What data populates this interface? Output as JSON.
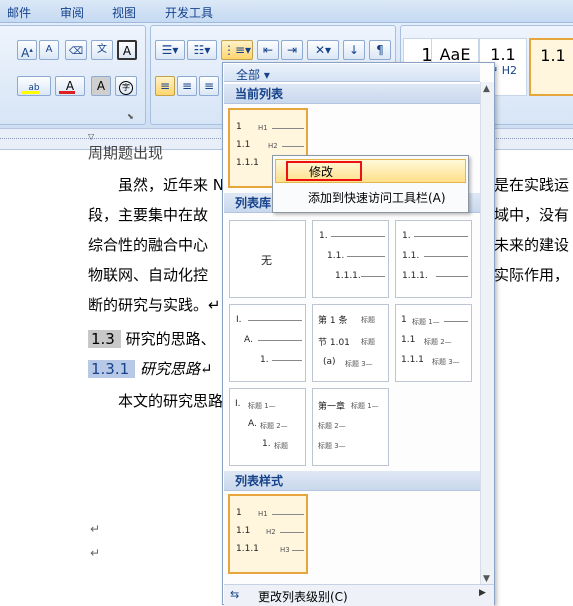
{
  "tabs": [
    "邮件",
    "审阅",
    "视图",
    "开发工具"
  ],
  "ribbon": {
    "font_grow": "A",
    "font_shrink": "A",
    "pinyin": "文",
    "wen_char": "文",
    "border_char": "A",
    "style_samples": [
      {
        "big": "1",
        "small": ""
      },
      {
        "big": "AaE",
        "small": ""
      },
      {
        "big": "1.1",
        "small": "↵ H2"
      },
      {
        "big": "1.1",
        "small": ""
      }
    ],
    "aa_box": "A",
    "circle_char": "字"
  },
  "document": {
    "line_top": "周期题出现",
    "line1_a": "虽然，近年来 N",
    "line1_b": "是在实践运",
    "line2_a": "段，主要集中在故",
    "line2_b": "域中，没有",
    "line3_a": "综合性的融合中心",
    "line3_b": "未来的建设",
    "line4_a": "物联网、自动化控",
    "line4_b": "实际作用，",
    "line5": "断的研究与实践。↵",
    "h13_num": "1.3",
    "h13_text": "研究的思路、",
    "h131_num": "1.3.1",
    "h131_text": "研究思路↵",
    "line6": "本文的研究思路",
    "para_mark1": "↵",
    "para_mark2": "↵"
  },
  "panel": {
    "all_label": "全部 ▾",
    "current_section": "当前列表",
    "library_section": "列表库",
    "styles_section": "列表样式",
    "none_label": "无",
    "footer_label": "更改列表级别(C)",
    "footer_accel": "C"
  },
  "current_tile": {
    "rows": [
      {
        "num": "1",
        "label": "H1"
      },
      {
        "num": "1.1",
        "label": "H2"
      },
      {
        "num": "1.1.1",
        "label": ""
      }
    ]
  },
  "library_tiles": [
    {
      "rows": [
        {
          "num": "1."
        },
        {
          "num": "1.1."
        },
        {
          "num": "1.1.1."
        }
      ]
    },
    {
      "rows": [
        {
          "num": "1."
        },
        {
          "num": "1.1."
        },
        {
          "num": "1.1.1."
        }
      ]
    },
    {
      "rows": [
        {
          "num": "I."
        },
        {
          "num": "A."
        },
        {
          "num": "1."
        }
      ]
    },
    {
      "rows": [
        {
          "num": "第 1 条",
          "label": "标题"
        },
        {
          "num": "节 1.01",
          "label": "标题"
        },
        {
          "num": "(a)",
          "label": "标题 3—"
        }
      ]
    },
    {
      "rows": [
        {
          "num": "1",
          "label": "标题 1—"
        },
        {
          "num": "1.1",
          "label": "标题 2—"
        },
        {
          "num": "1.1.1",
          "label": "标题 3—"
        }
      ]
    },
    {
      "rows": [
        {
          "num": "I.",
          "label": "标题 1—"
        },
        {
          "num": "A.",
          "label": "标题 2—"
        },
        {
          "num": "1.",
          "label": "标题"
        }
      ]
    },
    {
      "rows": [
        {
          "num": "第一章",
          "label": "标题 1—"
        },
        {
          "num": "",
          "label": "标题 2—"
        },
        {
          "num": "",
          "label": "标题 3—"
        }
      ]
    }
  ],
  "style_tile": {
    "rows": [
      {
        "num": "1",
        "label": "H1"
      },
      {
        "num": "1.1",
        "label": "H2"
      },
      {
        "num": "1.1.1",
        "label": "H3"
      }
    ]
  },
  "context_menu": {
    "items": [
      "修改",
      "添加到快速访问工具栏(A)"
    ]
  },
  "colors": {
    "highlight_yellow": "#ffff00",
    "font_red": "#e02020",
    "selection_orange": "#e6a63c"
  }
}
